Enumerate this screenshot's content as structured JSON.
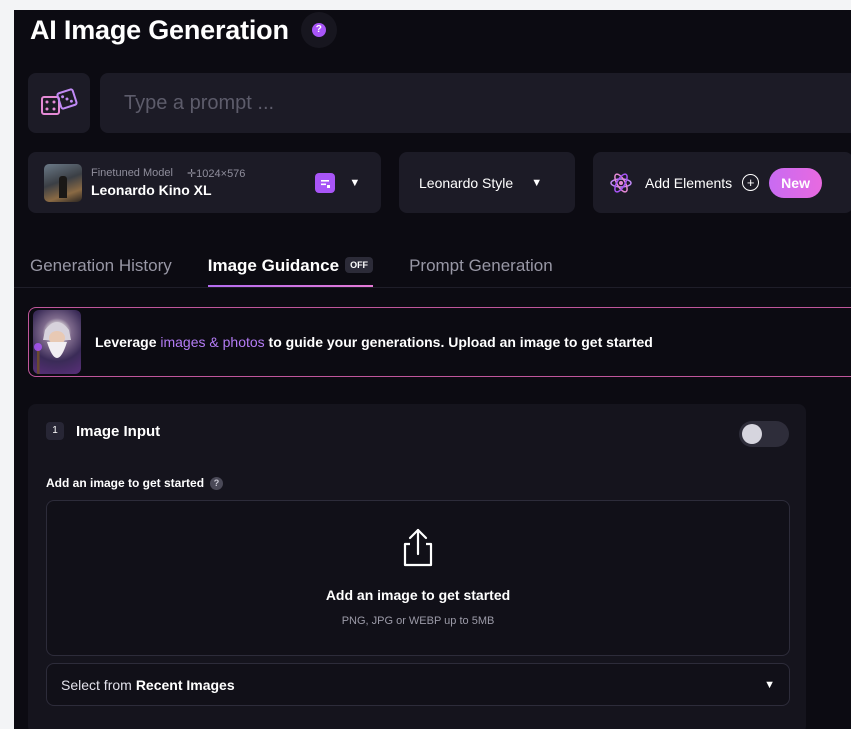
{
  "header": {
    "title": "AI Image Generation",
    "help_glyph": "?"
  },
  "prompt": {
    "placeholder": "Type a prompt ...",
    "value": "",
    "random_icon": "dice-icon"
  },
  "model": {
    "type_label": "Finetuned Model",
    "dimensions": "✛1024×576",
    "name": "Leonardo Kino XL",
    "icon": "preset-icon"
  },
  "style": {
    "label": "Leonardo Style"
  },
  "elements": {
    "label": "Add Elements",
    "plus": "+",
    "badge": "New",
    "icon": "atom-icon"
  },
  "tabs": [
    {
      "label": "Generation History",
      "active": false
    },
    {
      "label": "Image Guidance",
      "active": true,
      "badge": "OFF"
    },
    {
      "label": "Prompt Generation",
      "active": false
    }
  ],
  "banner": {
    "text_before": "Leverage ",
    "accent": "images & photos",
    "text_after": " to guide your generations. Upload an image to get started"
  },
  "image_input": {
    "step": "1",
    "title": "Image Input",
    "toggle_on": false,
    "add_label": "Add an image to get started",
    "help_glyph": "?",
    "drop_title": "Add an image to get started",
    "drop_subtitle": "PNG, JPG or WEBP up to 5MB",
    "recent_prefix": "Select from",
    "recent_strong": "Recent Images"
  },
  "colors": {
    "accent": "#a855f7",
    "background": "#0c0b12",
    "panel": "#15141d",
    "banner_border": "#c0569b"
  }
}
